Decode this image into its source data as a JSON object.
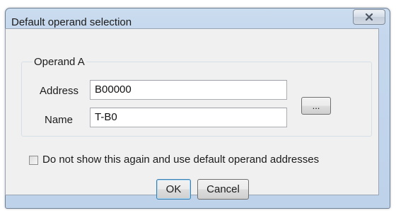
{
  "window": {
    "title": "Default operand selection",
    "close_icon": "close-x-icon"
  },
  "operand_group": {
    "legend": "Operand A",
    "address_label": "Address",
    "address_value": "B00000",
    "name_label": "Name",
    "name_value": "T-B0",
    "browse_label": "..."
  },
  "options": {
    "dont_show_label": "Do not show this again and use default operand addresses",
    "dont_show_checked": false
  },
  "buttons": {
    "ok_label": "OK",
    "cancel_label": "Cancel"
  },
  "colors": {
    "title_bar": "#c4d7ed",
    "client_background": "#f0f0f0",
    "default_button_border": "#3c7fb1"
  }
}
